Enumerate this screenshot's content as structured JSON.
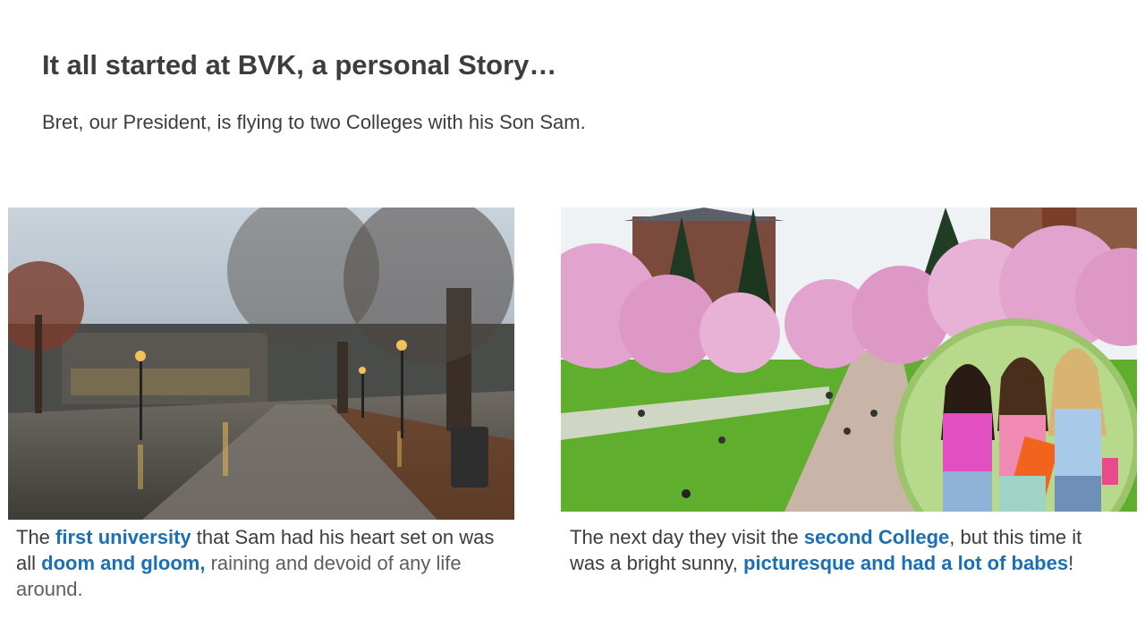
{
  "slide": {
    "title": "It all started at BVK, a personal Story…",
    "subtitle": "Bret, our President, is flying to two Colleges with his Son Sam."
  },
  "left_caption": {
    "part1": "The ",
    "hl1": "first university",
    "part2": " that Sam had his heart set on was all ",
    "hl2": "doom and gloom,",
    "part3": " raining and devoid of any life around."
  },
  "right_caption": {
    "part1": "The next day they visit the ",
    "hl1": "second College",
    "part2": ", but this time it was a bright sunny, ",
    "hl2": "picturesque and had a lot of babes",
    "part3": "!"
  },
  "colors": {
    "highlight": "#1a6fb5",
    "text": "#3d3d3d"
  }
}
